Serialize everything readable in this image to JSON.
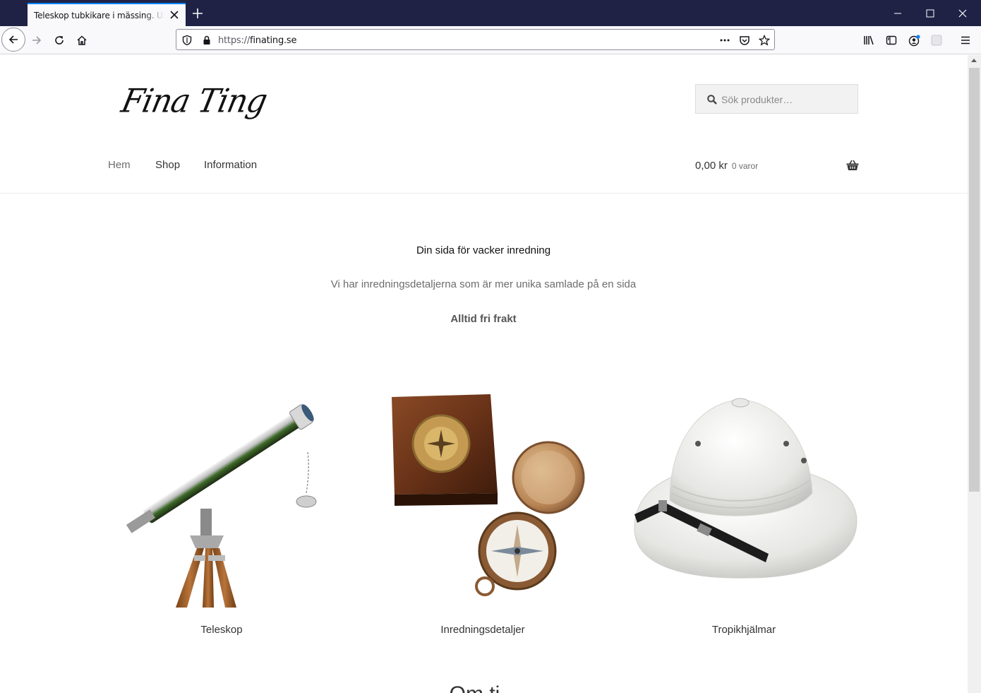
{
  "browser": {
    "tab_title": "Teleskop tubkikare i mässing. Unika",
    "url_protocol": "https://",
    "url_host": "finating.se",
    "chrome_color": "#1f2245",
    "accent_color": "#0a84ff"
  },
  "site": {
    "logo_text": "Fina Ting",
    "search_placeholder": "Sök produkter…",
    "nav": [
      {
        "label": "Hem",
        "active": true
      },
      {
        "label": "Shop",
        "active": false
      },
      {
        "label": "Information",
        "active": false
      }
    ],
    "cart": {
      "amount": "0,00 kr",
      "count": "0 varor",
      "icon": "basket-icon"
    }
  },
  "intro": {
    "title": "Din sida för vacker inredning",
    "subtitle": "Vi har inredningsdetaljerna som är mer unika samlade på en sida",
    "free_shipping": "Alltid fri frakt"
  },
  "categories": [
    {
      "label": "Teleskop",
      "image": "telescope-image"
    },
    {
      "label": "Inredningsdetaljer",
      "image": "compass-box-image"
    },
    {
      "label": "Tropikhjälmar",
      "image": "pith-helmet-image"
    }
  ],
  "next_section_heading_partial": "Om ti..."
}
